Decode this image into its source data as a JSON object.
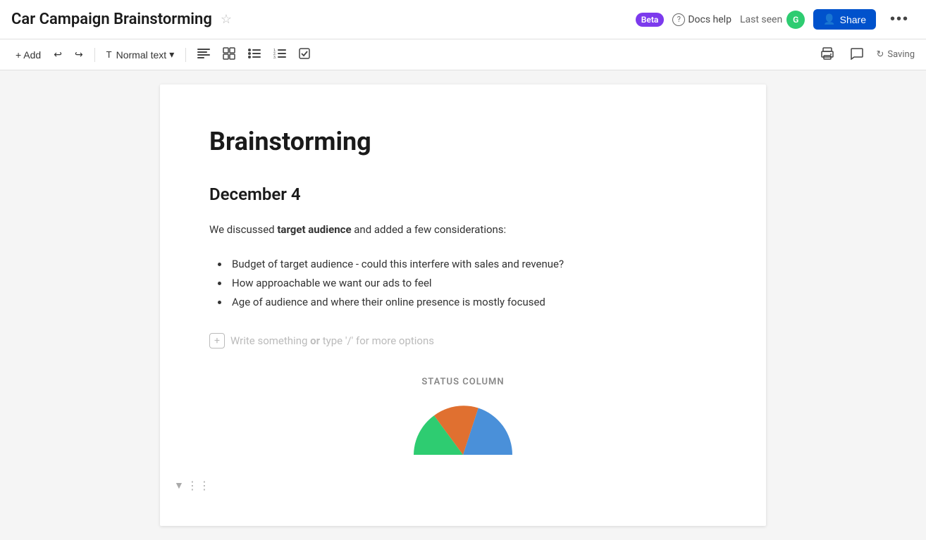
{
  "header": {
    "title": "Car Campaign Brainstorming",
    "star_icon": "☆",
    "beta_label": "Beta",
    "docs_help_label": "Docs help",
    "last_seen_label": "Last seen",
    "avatar_initial": "G",
    "share_label": "Share",
    "more_icon": "•••"
  },
  "toolbar": {
    "add_label": "+ Add",
    "undo_icon": "↩",
    "redo_icon": "↪",
    "text_style_label": "Normal text",
    "chevron": "▾",
    "align_icon": "≡",
    "table_icon": "⊞",
    "bullet_icon": "≡",
    "ordered_icon": "≡",
    "check_icon": "☑",
    "print_icon": "🖨",
    "comment_icon": "💬",
    "saving_label": "Saving"
  },
  "document": {
    "title": "Brainstorming",
    "date_heading": "December 4",
    "paragraph_before_bold": "We discussed ",
    "paragraph_bold": "target audience",
    "paragraph_after_bold": " and added a few considerations:",
    "list_items": [
      "Budget of target audience - could this interfere with sales and revenue?",
      "How approachable we want our ads to feel",
      "Age of audience and where their online presence is mostly focused"
    ],
    "write_placeholder_normal": "Write something ",
    "write_placeholder_bold": "or",
    "write_placeholder_rest": " type '/' for more options",
    "chart_label": "STATUS COLUMN"
  },
  "colors": {
    "share_btn": "#0073ea",
    "beta_bg": "#7c3aed",
    "avatar_bg": "#2ecc71",
    "pie_blue": "#4a90d9",
    "pie_orange": "#e07030",
    "pie_green": "#2ecc71"
  }
}
